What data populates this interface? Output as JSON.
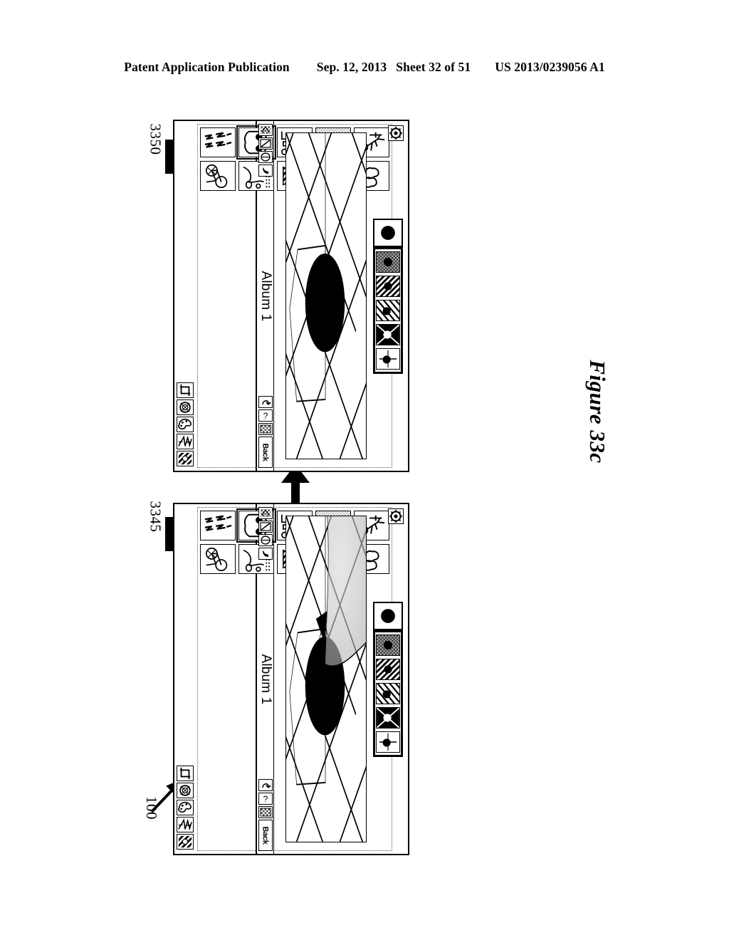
{
  "publication_header": {
    "left": "Patent Application Publication",
    "date": "Sep. 12, 2013",
    "sheet": "Sheet 32 of 51",
    "patent_number": "US 2013/0239056 A1"
  },
  "figure": {
    "caption": "Figure 33c",
    "reference_numerals": {
      "device": "100",
      "lower_state": "3345",
      "upper_state": "3350"
    }
  },
  "devices": [
    {
      "id": "upper-device",
      "ref": "3350",
      "navbar": {
        "back_label": "Back",
        "title": "Album 1",
        "right_icons": [
          "grid-icon",
          "help-icon",
          "undo-icon"
        ]
      },
      "statusbar_icons": [
        "signal-icon",
        "battery-icon",
        "clock-icon",
        "phone-icon"
      ],
      "gear_button": "gear-icon",
      "canvas": {
        "state": "flattened",
        "description": "Diamond lattice line drawing with large black ellipse and thin quadrilateral outline; page curl removed",
        "has_curl": false,
        "has_cursor": false
      },
      "palette": {
        "current_swatch": "solid-black-circle",
        "swatches": [
          "dark-checker-fill",
          "diagonal-hatch-fill",
          "diagonal-stripe-fill",
          "inverted-black-fill",
          "line-through-circle-fill"
        ],
        "selected_index": 0
      },
      "drawer": {
        "thumbnails_row1": [
          "horizon-plane-sketch",
          "bicycle-sketch",
          "figures-sketch",
          "car-sketch",
          "lightning-sketch"
        ],
        "thumbnails_row2": [
          "stick-figure-sketch",
          "clouds-sketch",
          "camera-figure-sketch",
          "cone-hatch-sketch",
          "landscape-sketch"
        ],
        "selected_thumbnail": "car-sketch",
        "shaded_thumbnail": "horizon-plane-sketch",
        "tools": [
          "texture-tool-icon",
          "brush-tool-icon",
          "palette-tool-icon",
          "shape-tool-icon",
          "crop-tool-icon"
        ]
      }
    },
    {
      "id": "lower-device",
      "ref": "3345",
      "navbar": {
        "back_label": "Back",
        "title": "Album 1",
        "right_icons": [
          "grid-icon",
          "help-icon",
          "undo-icon"
        ]
      },
      "statusbar_icons": [
        "signal-icon",
        "battery-icon",
        "clock-icon",
        "phone-icon"
      ],
      "gear_button": "gear-icon",
      "canvas": {
        "state": "page-curl-drag",
        "description": "Diamond lattice line drawing with large black ellipse; shaded page-curl peel region at upper right with drag cursor arrow",
        "has_curl": true,
        "has_cursor": true
      },
      "palette": {
        "current_swatch": "solid-black-circle",
        "swatches": [
          "dark-checker-fill",
          "diagonal-hatch-fill",
          "diagonal-stripe-fill",
          "inverted-black-fill",
          "line-through-circle-fill"
        ],
        "selected_index": 0
      },
      "drawer": {
        "thumbnails_row1": [
          "horizon-plane-sketch",
          "bicycle-sketch",
          "figures-sketch",
          "car-sketch",
          "lightning-sketch"
        ],
        "thumbnails_row2": [
          "stick-figure-sketch",
          "clouds-sketch",
          "camera-figure-sketch",
          "cone-hatch-sketch",
          "landscape-sketch"
        ],
        "selected_thumbnail": "car-sketch",
        "shaded_thumbnail": "horizon-plane-sketch",
        "tools": [
          "texture-tool-icon",
          "brush-tool-icon",
          "palette-tool-icon",
          "shape-tool-icon",
          "crop-tool-icon"
        ]
      }
    }
  ],
  "flow": {
    "arrow": "upward-transition-arrow"
  },
  "colors": {
    "ink": "#000000",
    "paper": "#ffffff",
    "shade": "#b8b8b8"
  }
}
